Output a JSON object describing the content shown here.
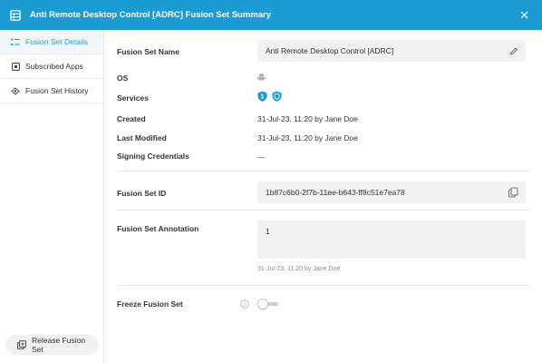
{
  "window": {
    "title": "Anti Remote Desktop Control [ADRC] Fusion Set Summary",
    "close_icon": "close-icon",
    "accent_color": "#1a9bd4"
  },
  "sidebar": {
    "items": [
      {
        "label": "Fusion Set Details",
        "icon": "list-icon",
        "active": true
      },
      {
        "label": "Subscribed Apps",
        "icon": "app-icon",
        "active": false
      },
      {
        "label": "Fusion Set History",
        "icon": "history-icon",
        "active": false
      }
    ],
    "release_button": "Release Fusion Set"
  },
  "details": {
    "name_label": "Fusion Set Name",
    "name_value": "Anti Remote Desktop Control [ADRC]",
    "os_label": "OS",
    "os_icon": "android-icon",
    "services_label": "Services",
    "services_badges": [
      "1",
      "shield"
    ],
    "created_label": "Created",
    "created_value": "31-Jul-23, 11:20 by Jane Doe",
    "modified_label": "Last Modified",
    "modified_value": "31-Jul-23, 11:20 by Jane Doe",
    "signing_label": "Signing Credentials",
    "signing_value": "—",
    "id_label": "Fusion Set ID",
    "id_value": "1b87c6b0-2f7b-11ee-b643-ff8c51e7ea78",
    "annotation_label": "Fusion Set Annotation",
    "annotation_value": "1",
    "annotation_meta": "31-Jul-23, 11:20 by Jane Doe",
    "freeze_label": "Freeze Fusion Set",
    "freeze_on": false
  }
}
